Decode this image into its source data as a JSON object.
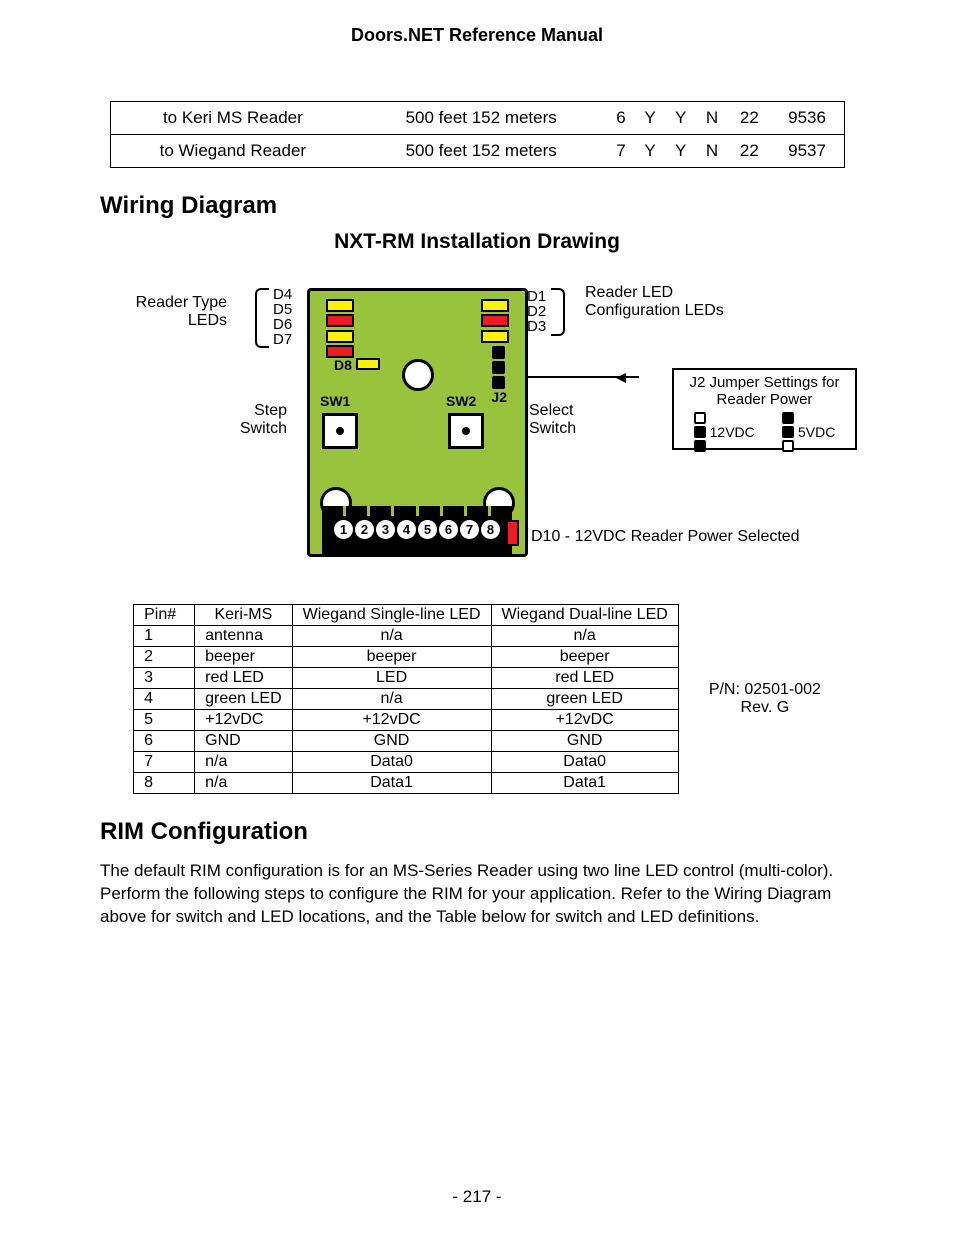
{
  "header": {
    "title": "Doors.NET Reference Manual"
  },
  "page_number": "- 217 -",
  "cable_table": {
    "rows": [
      {
        "c0": "to Keri MS Reader",
        "c1": "500 feet 152 meters",
        "c2": "6",
        "c3": "Y",
        "c4": "Y",
        "c5": "N",
        "c6": "22",
        "c7": "9536"
      },
      {
        "c0": "to Wiegand Reader",
        "c1": "500 feet 152 meters",
        "c2": "7",
        "c3": "Y",
        "c4": "Y",
        "c5": "N",
        "c6": "22",
        "c7": "9537"
      }
    ]
  },
  "section1_title": "Wiring Diagram",
  "drawing_title": "NXT-RM Installation Drawing",
  "diagram": {
    "left_d": {
      "d4": "D4",
      "d5": "D5",
      "d6": "D6",
      "d7": "D7"
    },
    "right_d": {
      "d1": "D1",
      "d2": "D2",
      "d3": "D3"
    },
    "d8": "D8",
    "j2": "J2",
    "sw1": "SW1",
    "sw2": "SW2",
    "reader_type_leds": "Reader Type LEDs",
    "reader_led_cfg": "Reader LED Configuration LEDs",
    "step_switch": "Step Switch",
    "select_switch": "Select Switch",
    "j2_box_title": "J2 Jumper Settings for Reader Power",
    "j2_12v": "12VDC",
    "j2_5v": "5VDC",
    "d10_label": "D10 - 12VDC Reader Power Selected",
    "terminals": [
      "1",
      "2",
      "3",
      "4",
      "5",
      "6",
      "7",
      "8"
    ]
  },
  "pin_table": {
    "headers": {
      "pin": "Pin#",
      "keri": "Keri-MS",
      "wsingle": "Wiegand Single-line LED",
      "wdual": "Wiegand Dual-line LED"
    },
    "rows": [
      {
        "pin": "1",
        "keri": "antenna",
        "wsingle": "n/a",
        "wdual": "n/a"
      },
      {
        "pin": "2",
        "keri": "beeper",
        "wsingle": "beeper",
        "wdual": "beeper"
      },
      {
        "pin": "3",
        "keri": "red LED",
        "wsingle": "LED",
        "wdual": "red LED"
      },
      {
        "pin": "4",
        "keri": "green LED",
        "wsingle": "n/a",
        "wdual": "green LED"
      },
      {
        "pin": "5",
        "keri": "+12vDC",
        "wsingle": "+12vDC",
        "wdual": "+12vDC"
      },
      {
        "pin": "6",
        "keri": "GND",
        "wsingle": "GND",
        "wdual": "GND"
      },
      {
        "pin": "7",
        "keri": "n/a",
        "wsingle": "Data0",
        "wdual": "Data0"
      },
      {
        "pin": "8",
        "keri": "n/a",
        "wsingle": "Data1",
        "wdual": "Data1"
      }
    ]
  },
  "pn_block": {
    "pn": "P/N: 02501-002",
    "rev": "Rev. G"
  },
  "section2_title": "RIM Configuration",
  "body_text": "The default RIM configuration is for an MS-Series Reader using two line LED control (multi-color). Perform the following steps to configure the RIM for your application. Refer to the Wiring Diagram above for switch and LED locations, and the Table below for switch and LED definitions."
}
